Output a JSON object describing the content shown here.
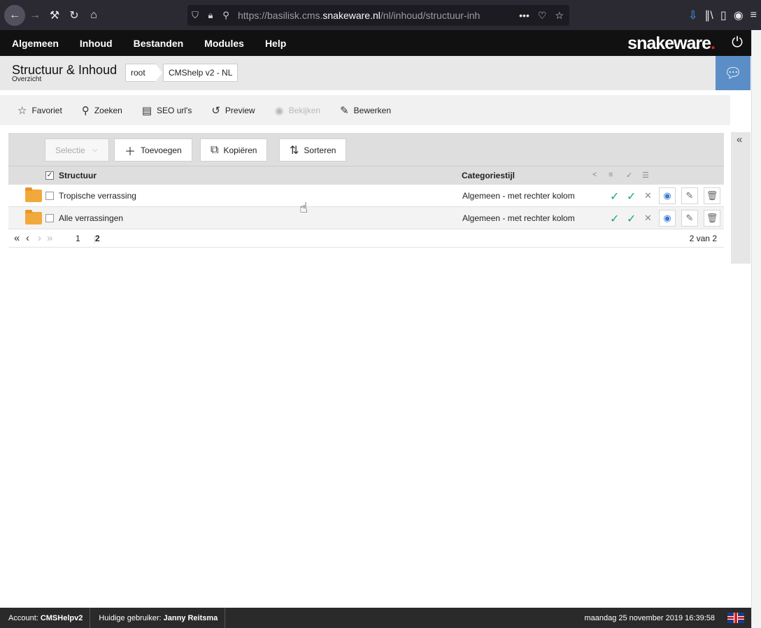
{
  "browser": {
    "url_prefix": "https://basilisk.cms.",
    "url_domain": "snakeware.nl",
    "url_path": "/nl/inhoud/structuur-inh",
    "dots": "•••"
  },
  "nav": {
    "items": [
      "Algemeen",
      "Inhoud",
      "Bestanden",
      "Modules",
      "Help"
    ],
    "logo_main": "snakeware",
    "logo_dot": "."
  },
  "header": {
    "title": "Structuur & Inhoud",
    "subtitle": "Overzicht",
    "breadcrumb": [
      "root",
      "CMShelp v2 - NL"
    ]
  },
  "toolbar": {
    "favoriet": "Favoriet",
    "zoeken": "Zoeken",
    "seo": "SEO url's",
    "preview": "Preview",
    "bekijken": "Bekijken",
    "bewerken": "Bewerken"
  },
  "grid": {
    "selectie": "Selectie",
    "toevoegen": "Toevoegen",
    "kopieren": "Kopiëren",
    "sorteren": "Sorteren",
    "col_structuur": "Structuur",
    "col_categorie": "Categoriestijl",
    "rows": [
      {
        "name": "Tropische verrassing",
        "categorie": "Algemeen - met rechter kolom"
      },
      {
        "name": "Alle verrassingen",
        "categorie": "Algemeen - met rechter kolom"
      }
    ],
    "pager": {
      "page1": "1",
      "page2": "2",
      "count": "2 van 2"
    }
  },
  "status": {
    "account_label": "Account:",
    "account_value": "CMSHelpv2",
    "user_label": "Huidige gebruiker:",
    "user_value": "Janny Reitsma",
    "datetime": "maandag 25 november 2019 16:39:58"
  },
  "colors": {
    "accent": "#5b8ec7",
    "check": "#20a08a",
    "folder": "#f2a93b"
  }
}
